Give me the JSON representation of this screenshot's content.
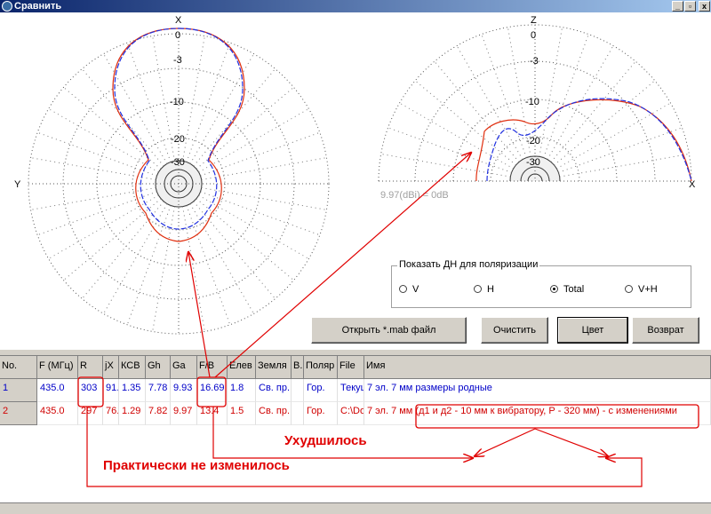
{
  "window": {
    "title": "Сравнить",
    "controls": [
      "_",
      "▫",
      "x"
    ]
  },
  "plots": {
    "left": {
      "top_label": "X",
      "side_label": "Y",
      "rings": [
        "0",
        "-3",
        "-10",
        "-20",
        "-30"
      ]
    },
    "right": {
      "top_label": "Z",
      "side_label": "X",
      "rings": [
        "0",
        "-3",
        "-10",
        "-20",
        "-30"
      ],
      "gain_note": "9.97(dBi) = 0dB"
    }
  },
  "polarization": {
    "title": "Показать ДН для поляризации",
    "options": [
      {
        "label": "V",
        "selected": false
      },
      {
        "label": "H",
        "selected": false
      },
      {
        "label": "Total",
        "selected": true
      },
      {
        "label": "V+H",
        "selected": false
      }
    ]
  },
  "buttons": {
    "open": "Открыть *.mab файл",
    "clear": "Очистить",
    "color": "Цвет",
    "back": "Возврат"
  },
  "table": {
    "columns": [
      "No.",
      "F (МГц)",
      "R",
      "jX",
      "КСВ",
      "Gh",
      "Ga",
      "F/B",
      "Елев",
      "Земля",
      "В.",
      "Поляр",
      "File",
      "Имя"
    ],
    "rows": [
      {
        "color": "#0000c8",
        "cells": [
          "1",
          "435.0",
          "303",
          "91.",
          "1.35",
          "7.78",
          "9.93",
          "16.69",
          "1.8",
          "Св. пр.",
          "",
          "Гор.",
          "Текущ",
          "7 эл. 7 мм размеры родные"
        ]
      },
      {
        "color": "#d00000",
        "cells": [
          "2",
          "435.0",
          "297",
          "76.",
          "1.29",
          "7.82",
          "9.97",
          "13.4",
          "1.5",
          "Св. пр.",
          "",
          "Гор.",
          "C:\\Do",
          "7 эл. 7 мм (д1 и д2 - 10 мм к вибратору, Р - 320 мм) - с изменениями"
        ]
      }
    ]
  },
  "annotations": {
    "worse": "Ухудшилось",
    "unchanged": "Практически не изменилось"
  },
  "colors": {
    "series1": "#0000c8",
    "series2": "#e03010",
    "annotation": "#e00000"
  }
}
